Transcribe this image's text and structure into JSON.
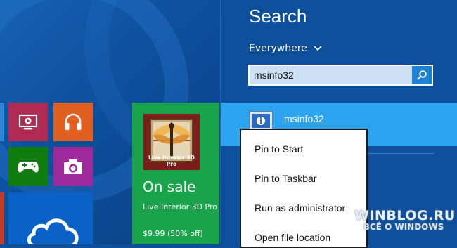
{
  "start_screen": {
    "tiles": [
      {
        "name": "video",
        "color": "#b12a53",
        "icon": "video-icon"
      },
      {
        "name": "music",
        "color": "#e25f22",
        "icon": "headphones-icon"
      },
      {
        "name": "games",
        "color": "#107c10",
        "icon": "gamepad-icon"
      },
      {
        "name": "camera",
        "color": "#9c2a9a",
        "icon": "camera-icon"
      },
      {
        "name": "onedrive",
        "color": "#0a62c7",
        "icon": "cloud-icon"
      }
    ],
    "store_tile": {
      "app_image_caption": "Live Interior 3D Pro",
      "headline": "On sale",
      "app_name": "Live Interior 3D Pro",
      "price": "$9.99 (50% off)",
      "color": "#1aa34a"
    }
  },
  "search_charm": {
    "title": "Search",
    "scope": "Everywhere",
    "query": "msinfo32",
    "search_button_icon": "search-icon",
    "result": {
      "label": "msinfo32",
      "icon": "system-info-icon"
    }
  },
  "context_menu": {
    "items": [
      "Pin to Start",
      "Pin to Taskbar",
      "Run as administrator",
      "Open file location"
    ]
  },
  "watermark": {
    "main": "WINBLOG.RU",
    "sub": "ВСЁ О WINDOWS"
  }
}
